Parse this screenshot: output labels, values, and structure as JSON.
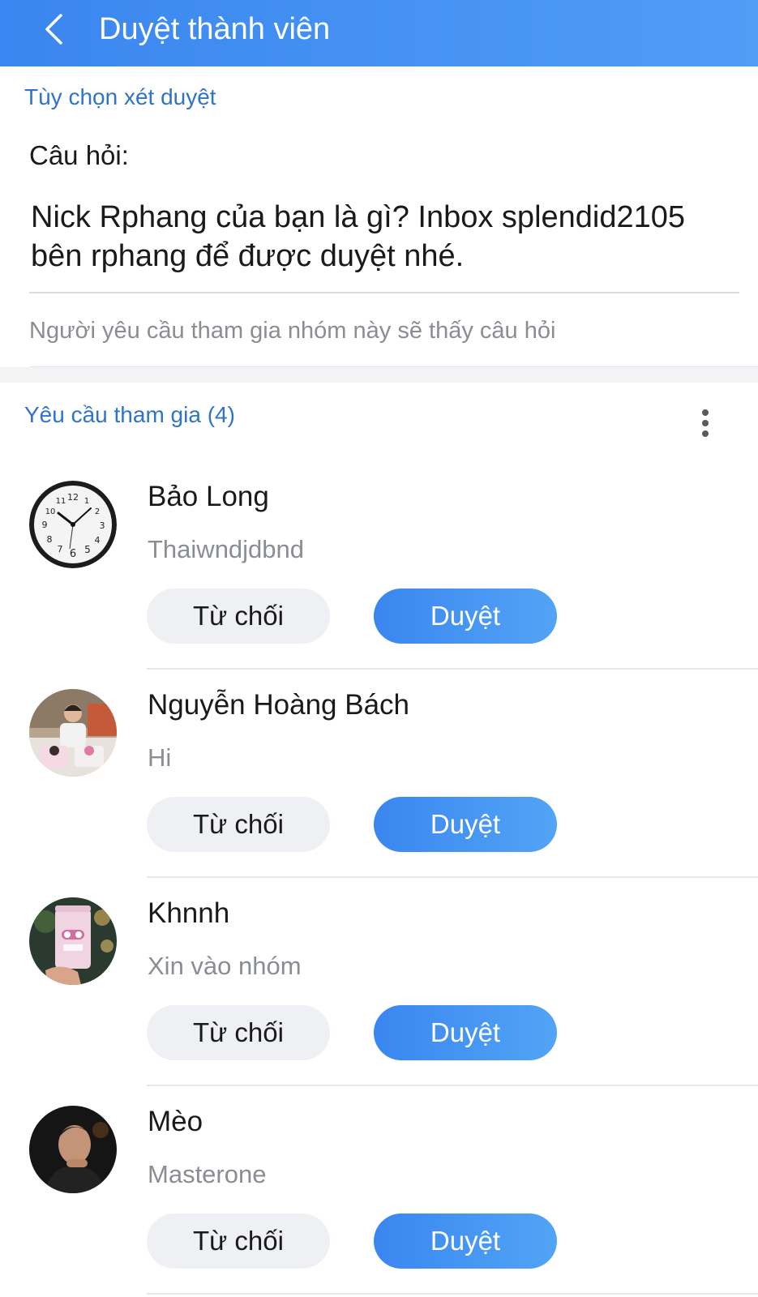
{
  "header": {
    "back_icon": "chevron-left-icon",
    "title": "Duyệt thành viên"
  },
  "review_options": {
    "section_title": "Tùy chọn xét duyệt",
    "question_label": "Câu hỏi:",
    "question_text": "Nick Rphang của bạn là gì? Inbox splendid2105 bên rphang để được duyệt nhé.",
    "hint": "Người yêu cầu tham gia nhóm này sẽ thấy câu hỏi"
  },
  "requests_section": {
    "title": "Yêu cầu tham gia (4)",
    "more_icon": "more-vertical-icon"
  },
  "requests": [
    {
      "name": "Bảo Long",
      "answer": "Thaiwndjdbnd",
      "reject_label": "Từ chối",
      "approve_label": "Duyệt",
      "avatar": "clock-image"
    },
    {
      "name": "Nguyễn Hoàng Bách",
      "answer": "Hi",
      "reject_label": "Từ chối",
      "approve_label": "Duyệt",
      "avatar": "person-photo"
    },
    {
      "name": "Khnnh",
      "answer": "Xin vào nhóm",
      "reject_label": "Từ chối",
      "approve_label": "Duyệt",
      "avatar": "drink-cup-photo"
    },
    {
      "name": "Mèo",
      "answer": "Masterone",
      "reject_label": "Từ chối",
      "approve_label": "Duyệt",
      "avatar": "person-dark-photo"
    }
  ],
  "colors": {
    "accent": "#3a86f0",
    "link_blue": "#2f74c9",
    "muted_text": "#8a8d91",
    "reject_bg": "#eff0f3"
  }
}
